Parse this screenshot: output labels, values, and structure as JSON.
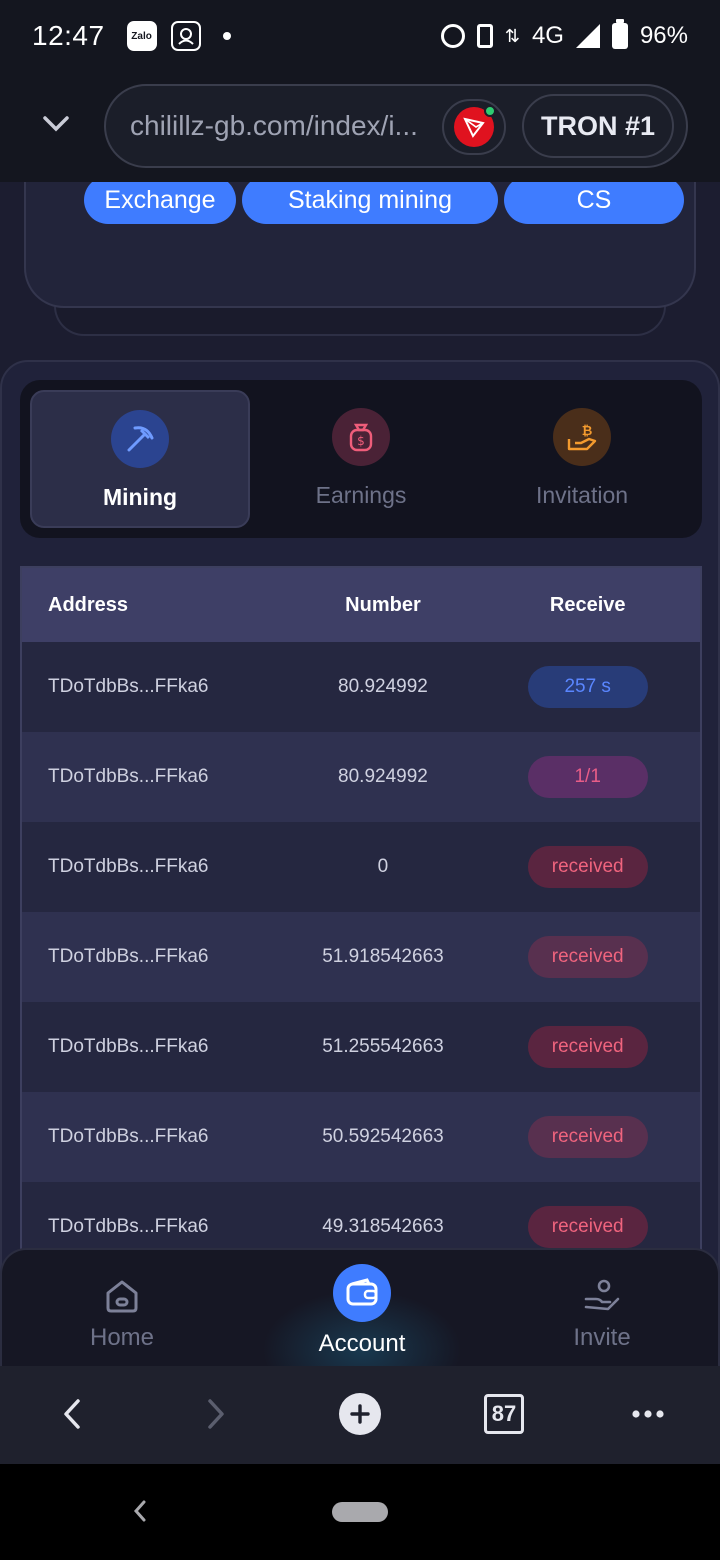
{
  "status_bar": {
    "time": "12:47",
    "network": "4G",
    "battery": "96%",
    "apps": [
      "Zalo",
      "app-icon"
    ]
  },
  "browser": {
    "url": "chilillz-gb.com/index/i...",
    "network_button": "TRON #1",
    "tabs_count": "87"
  },
  "top_card": {
    "actions": [
      "Exchange",
      "Staking mining",
      "CS"
    ]
  },
  "tabs": [
    {
      "label": "Mining",
      "icon": "pickaxe-icon",
      "active": true
    },
    {
      "label": "Earnings",
      "icon": "money-bag-icon",
      "active": false
    },
    {
      "label": "Invitation",
      "icon": "bitcoin-hand-icon",
      "active": false
    }
  ],
  "table": {
    "headers": {
      "address": "Address",
      "number": "Number",
      "receive": "Receive"
    },
    "rows": [
      {
        "address": "TDoTdbBs...FFka6",
        "number": "80.924992",
        "receive": "257 s",
        "type": "countdown"
      },
      {
        "address": "TDoTdbBs...FFka6",
        "number": "80.924992",
        "receive": "1/1",
        "type": "fraction"
      },
      {
        "address": "TDoTdbBs...FFka6",
        "number": "0",
        "receive": "received",
        "type": "received"
      },
      {
        "address": "TDoTdbBs...FFka6",
        "number": "51.918542663",
        "receive": "received",
        "type": "received"
      },
      {
        "address": "TDoTdbBs...FFka6",
        "number": "51.255542663",
        "receive": "received",
        "type": "received"
      },
      {
        "address": "TDoTdbBs...FFka6",
        "number": "50.592542663",
        "receive": "received",
        "type": "received"
      },
      {
        "address": "TDoTdbBs...FFka6",
        "number": "49.318542663",
        "receive": "received",
        "type": "received"
      }
    ]
  },
  "bottom_nav": {
    "items": [
      {
        "label": "Home",
        "icon": "home-icon"
      },
      {
        "label": "Account",
        "icon": "wallet-icon"
      },
      {
        "label": "Invite",
        "icon": "invite-icon"
      }
    ],
    "active_index": 1
  },
  "colors": {
    "accent": "#3f7cff",
    "background": "#1c1d30",
    "received_pill": "#5a2540",
    "countdown_pill": "#283c78"
  }
}
